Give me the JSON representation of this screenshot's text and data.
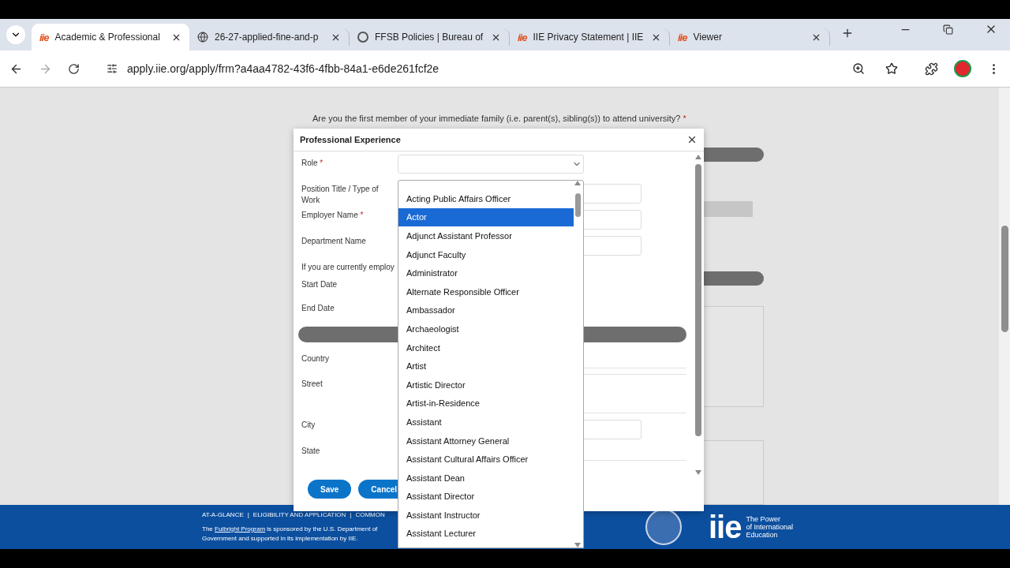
{
  "browser": {
    "tabs": [
      {
        "title": "Academic & Professional",
        "selected": true,
        "kind": "iie"
      },
      {
        "title": "26-27-applied-fine-and-p",
        "selected": false,
        "kind": "globe"
      },
      {
        "title": "FFSB Policies | Bureau of",
        "selected": false,
        "kind": "seal"
      },
      {
        "title": "IIE Privacy Statement | IIE",
        "selected": false,
        "kind": "iie"
      },
      {
        "title": "Viewer",
        "selected": false,
        "kind": "iie"
      }
    ],
    "url": "apply.iie.org/apply/frm?a4aa4782-43f6-4fbb-84a1-e6de261fcf2e"
  },
  "page": {
    "question": "Are you the first member of your immediate family (i.e. parent(s), sibling(s)) to attend university?",
    "required_mark": "*"
  },
  "dialog": {
    "title": "Professional Experience",
    "fields": [
      {
        "label": "Role",
        "required": true,
        "kind": "select"
      },
      {
        "label": "Position Title / Type of Work",
        "required": false,
        "kind": "input"
      },
      {
        "label": "Employer Name",
        "required": true,
        "kind": "input"
      },
      {
        "label": "Department Name",
        "required": false,
        "kind": "input"
      },
      {
        "label": "If you are currently employ",
        "required": false,
        "kind": "note"
      },
      {
        "label": "Start Date",
        "required": false,
        "kind": "plain"
      },
      {
        "label": "End Date",
        "required": false,
        "kind": "plain"
      },
      {
        "kind": "bar"
      },
      {
        "label": "Country",
        "required": false,
        "kind": "line"
      },
      {
        "label": "Street",
        "required": false,
        "kind": "textarea"
      },
      {
        "label": "City",
        "required": false,
        "kind": "input"
      },
      {
        "label": "State",
        "required": false,
        "kind": "line"
      }
    ],
    "buttons": [
      "Save",
      "Cancel"
    ]
  },
  "dropdown": {
    "options": [
      {
        "label": "Acting Public Affairs Officer",
        "selected": false
      },
      {
        "label": "Actor",
        "selected": true
      },
      {
        "label": "Adjunct Assistant Professor",
        "selected": false
      },
      {
        "label": "Adjunct Faculty",
        "selected": false
      },
      {
        "label": "Administrator",
        "selected": false
      },
      {
        "label": "Alternate Responsible Officer",
        "selected": false
      },
      {
        "label": "Ambassador",
        "selected": false
      },
      {
        "label": "Archaeologist",
        "selected": false
      },
      {
        "label": "Architect",
        "selected": false
      },
      {
        "label": "Artist",
        "selected": false
      },
      {
        "label": "Artistic Director",
        "selected": false
      },
      {
        "label": "Artist-in-Residence",
        "selected": false
      },
      {
        "label": "Assistant",
        "selected": false
      },
      {
        "label": "Assistant Attorney General",
        "selected": false
      },
      {
        "label": "Assistant Cultural Affairs Officer",
        "selected": false
      },
      {
        "label": "Assistant Dean",
        "selected": false
      },
      {
        "label": "Assistant Director",
        "selected": false
      },
      {
        "label": "Assistant Instructor",
        "selected": false
      },
      {
        "label": "Assistant Lecturer",
        "selected": false
      }
    ]
  },
  "footer": {
    "links": [
      "AT-A-GLANCE",
      "ELIGIBILITY AND APPLICATION",
      "COMMON"
    ],
    "separator": "|",
    "sponsor_before": "The ",
    "sponsor_link": "Fulbright Program",
    "sponsor_after": " is sponsored by the U.S. Department of",
    "sponsor_line2": "Government and supported in its implementation by IIE.",
    "logo_mark": "iie",
    "logo_tagline": [
      "The Power",
      "of International",
      "Education"
    ]
  }
}
